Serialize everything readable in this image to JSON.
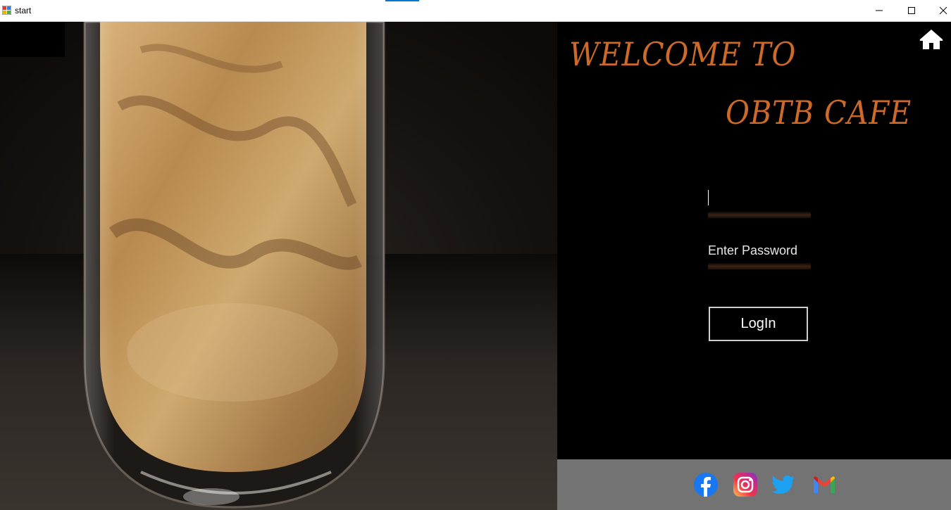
{
  "window": {
    "title": "start"
  },
  "welcome": {
    "line1": "WELCOME TO",
    "line2": "OBTB CAFE"
  },
  "login_form": {
    "username_value": "",
    "password_placeholder": "Enter Password",
    "login_label": "LogIn"
  },
  "colors": {
    "accent": "#cd6a2a",
    "background": "#000000",
    "footer": "#737373",
    "titlebar_accent": "#0078d7"
  },
  "icons": {
    "home": "home-icon",
    "social": [
      "facebook-icon",
      "instagram-icon",
      "twitter-icon",
      "gmail-icon"
    ]
  }
}
